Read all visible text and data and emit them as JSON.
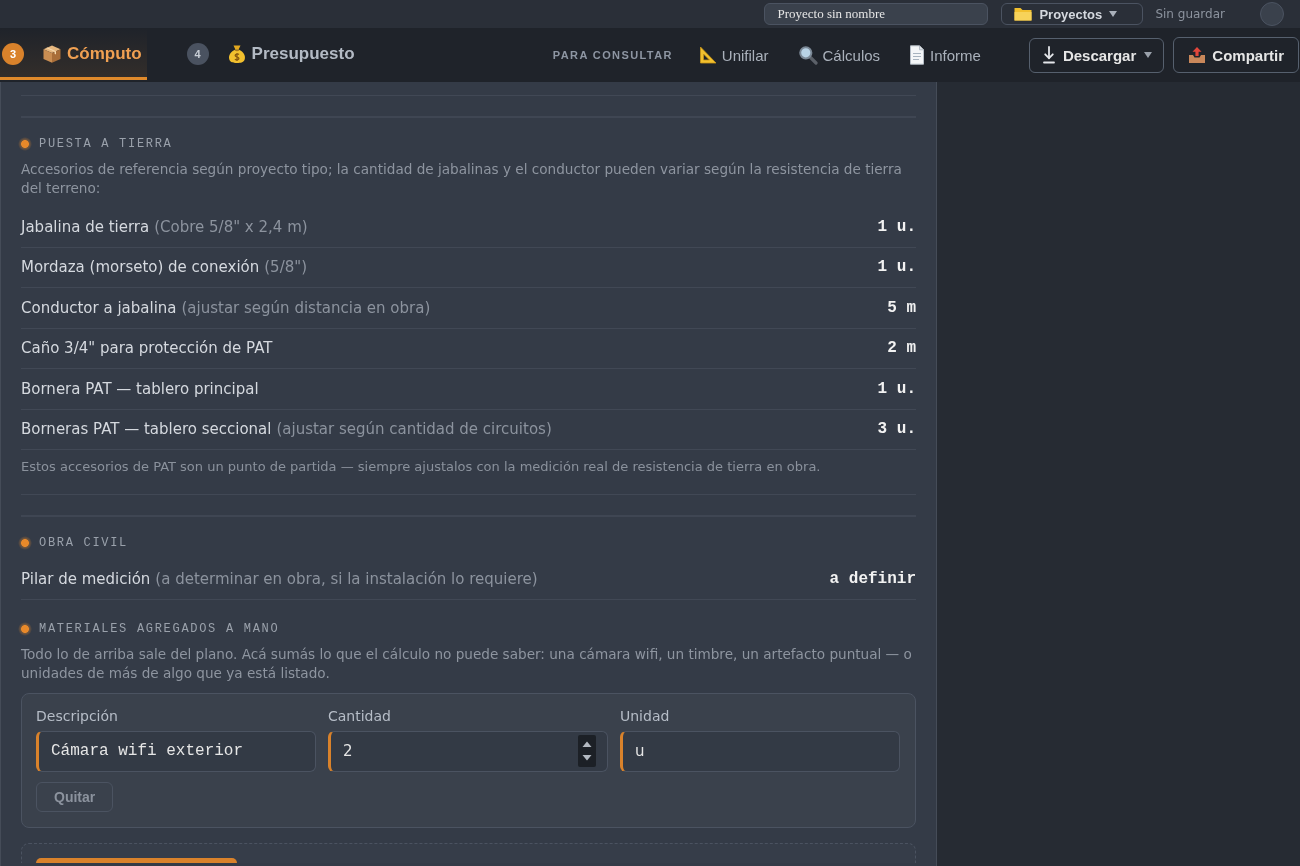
{
  "top_bar": {
    "project_name": "Proyecto sin nombre",
    "projects_button": "Proyectos",
    "save_status": "Sin guardar"
  },
  "tabs": [
    {
      "step": "3",
      "label": "Cómputo",
      "selected": true
    },
    {
      "step": "4",
      "label": "Presupuesto",
      "selected": false
    }
  ],
  "consult": {
    "heading": "PARA CONSULTAR",
    "links": [
      {
        "label": "Unifilar"
      },
      {
        "label": "Cálculos"
      },
      {
        "label": "Informe"
      }
    ]
  },
  "actions": [
    {
      "kind": "download",
      "label": "Descargar"
    },
    {
      "kind": "share",
      "label": "Compartir"
    }
  ],
  "sections": [
    {
      "title": "PUESTA A TIERRA",
      "description": "Accesorios de referencia según proyecto tipo; la cantidad de jabalinas y el conductor pueden variar según la resistencia de tierra del terreno:",
      "items": [
        {
          "name": "Jabalina de tierra",
          "detail": "(Cobre 5/8\" x 2,4 m)",
          "quantity": "1 u."
        },
        {
          "name": "Mordaza (morseto) de conexión",
          "detail": "(5/8\")",
          "quantity": "1 u."
        },
        {
          "name": "Conductor a jabalina",
          "detail": "(ajustar según distancia en obra)",
          "quantity": "5 m"
        },
        {
          "name": "Caño 3/4\" para protección de PAT",
          "quantity": "2 m"
        },
        {
          "name": "Bornera PAT — tablero principal",
          "quantity": "1 u."
        },
        {
          "name": "Borneras PAT — tablero seccional",
          "detail": "(ajustar según cantidad de circuitos)",
          "quantity": "3 u."
        }
      ],
      "note": "Estos accesorios de PAT son un punto de partida — siempre ajustalos con la medición real de resistencia de tierra en obra."
    },
    {
      "title": "OBRA CIVIL",
      "items": [
        {
          "name": "Pilar de medición",
          "detail": "(a determinar en obra, si la instalación lo requiere)",
          "quantity": "a definir"
        }
      ]
    }
  ],
  "manual_materials": {
    "title": "MATERIALES AGREGADOS A MANO",
    "description": "Todo lo de arriba sale del plano. Acá sumás lo que el cálculo no puede saber: una cámara wifi, un timbre, un artefacto puntual — o unidades de más de algo que ya está listado.",
    "entries": [
      {
        "fields": [
          {
            "kind": "description",
            "label": "Descripción",
            "value": "Cámara wifi exterior"
          },
          {
            "kind": "quantity",
            "label": "Cantidad",
            "value": "2"
          },
          {
            "kind": "unit",
            "label": "Unidad",
            "value": "u"
          }
        ],
        "remove_label": "Quitar"
      }
    ]
  }
}
